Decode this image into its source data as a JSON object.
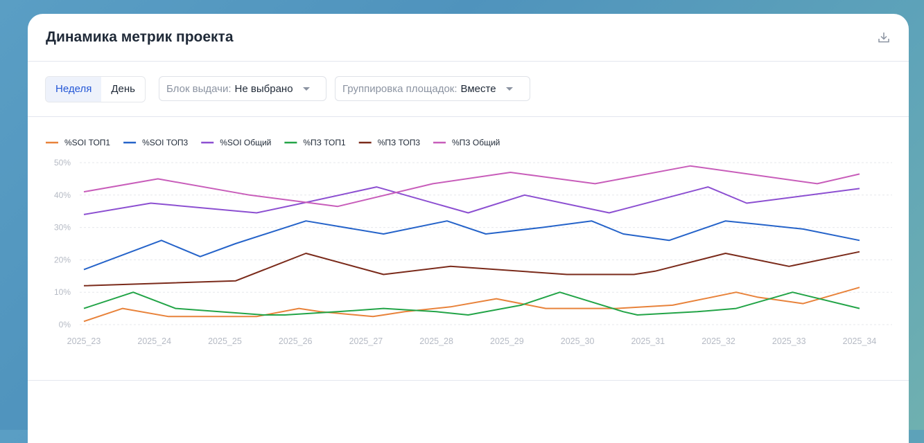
{
  "header": {
    "title": "Динамика метрик проекта",
    "download_icon": "download-icon"
  },
  "filters": {
    "period_tabs": [
      {
        "label": "Неделя",
        "active": true
      },
      {
        "label": "День",
        "active": false
      }
    ],
    "block": {
      "label": "Блок выдачи:",
      "value": "Не выбрано"
    },
    "grouping": {
      "label": "Группировка площадок:",
      "value": "Вместе"
    }
  },
  "chart_data": {
    "type": "line",
    "categories": [
      "2025_23",
      "2025_24",
      "2025_25",
      "2025_26",
      "2025_27",
      "2025_28",
      "2025_29",
      "2025_30",
      "2025_31",
      "2025_32",
      "2025_33",
      "2025_34"
    ],
    "y_ticks": [
      "0%",
      "10%",
      "20%",
      "30%",
      "40%",
      "50%"
    ],
    "ylim": [
      0,
      50
    ],
    "legend_position": "top-left",
    "grid": true,
    "series": [
      {
        "name": "%SOI ТОП1",
        "color": "#e8823a",
        "x": [
          0,
          0.55,
          1.2,
          2.1,
          2.45,
          3.05,
          3.35,
          4.1,
          4.25,
          4.55,
          5.2,
          5.85,
          6.55,
          7.55,
          8.35,
          9.25,
          9.55,
          10.2,
          11.0
        ],
        "values": [
          1,
          5,
          2.5,
          2.5,
          2.5,
          5,
          4,
          2.5,
          3,
          4,
          5.5,
          8,
          5,
          5,
          6,
          10,
          8.5,
          6.5,
          11.5
        ]
      },
      {
        "name": "%SOI ТОП3",
        "color": "#2563c9",
        "x": [
          0,
          1.1,
          1.65,
          2.15,
          3.15,
          4.25,
          5.15,
          5.7,
          6.5,
          7.2,
          7.65,
          8.3,
          9.1,
          9.55,
          10.2,
          11.0
        ],
        "values": [
          17,
          26,
          21,
          25,
          32,
          28,
          32,
          28,
          30,
          32,
          28,
          26,
          32,
          31,
          29.5,
          26
        ]
      },
      {
        "name": "%SOI Общий",
        "color": "#8c4fd1",
        "x": [
          0,
          0.95,
          2.45,
          3.1,
          4.15,
          5.45,
          6.25,
          7.45,
          8.85,
          9.4,
          11.0
        ],
        "values": [
          34,
          37.5,
          34.5,
          37.5,
          42.5,
          34.5,
          40,
          34.5,
          42.5,
          37.5,
          42
        ]
      },
      {
        "name": "%ПЗ ТОП1",
        "color": "#22a447",
        "x": [
          0,
          0.7,
          1.3,
          2.55,
          2.85,
          3.6,
          4.25,
          5.0,
          5.45,
          6.2,
          6.75,
          7.65,
          7.85,
          8.7,
          9.25,
          10.05,
          11.0
        ],
        "values": [
          5,
          10,
          5,
          3,
          3,
          4,
          5,
          4,
          3,
          6,
          10,
          4,
          3,
          4,
          5,
          10,
          5
        ]
      },
      {
        "name": "%ПЗ ТОП3",
        "color": "#7a2a1a",
        "x": [
          0,
          2.15,
          3.15,
          4.25,
          5.2,
          6.85,
          7.8,
          8.1,
          9.1,
          10.0,
          11.0
        ],
        "values": [
          12,
          13.5,
          22,
          15.5,
          18,
          15.5,
          15.5,
          16.5,
          22,
          18,
          22.5
        ]
      },
      {
        "name": "%ПЗ Общий",
        "color": "#c85dba",
        "x": [
          0,
          1.05,
          2.35,
          3.6,
          4.95,
          6.05,
          7.25,
          8.6,
          10.4,
          11.0
        ],
        "values": [
          41,
          45,
          40,
          36.5,
          43.5,
          47,
          43.5,
          49,
          43.5,
          46.5
        ]
      }
    ]
  }
}
